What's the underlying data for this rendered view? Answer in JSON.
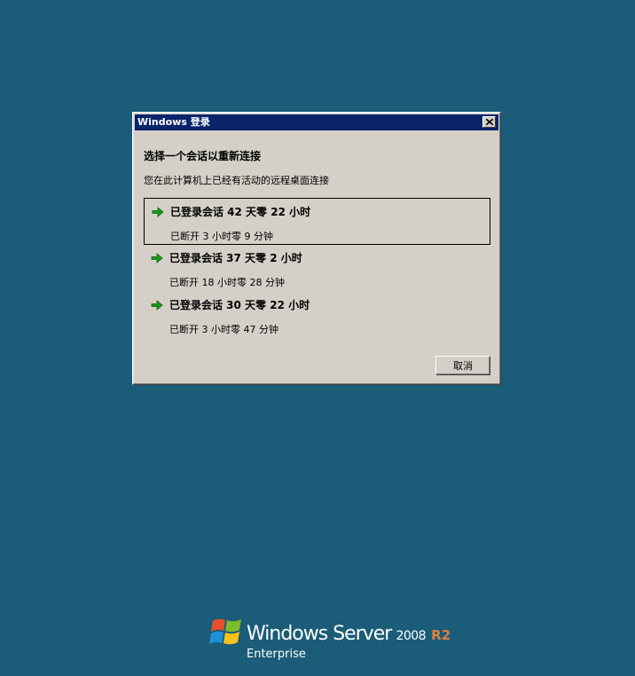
{
  "dialog": {
    "title": "Windows 登录",
    "heading": "选择一个会话以重新连接",
    "subheading": "您在此计算机上已经有活动的远程桌面连接",
    "sessions": [
      {
        "title": "已登录会话 42 天零 22 小时",
        "status": "已断开 3 小时零 9 分钟",
        "selected": true
      },
      {
        "title": "已登录会话 37 天零 2 小时",
        "status": "已断开 18 小时零 28 分钟",
        "selected": false
      },
      {
        "title": "已登录会话 30 天零 22 小时",
        "status": "已断开 3 小时零 47 分钟",
        "selected": false
      }
    ],
    "cancel_label": "取消",
    "icons": {
      "close": "close-icon",
      "session_arrow": "green-arrow-icon"
    }
  },
  "branding": {
    "product": "Windows Server",
    "version": "2008",
    "release": "R2",
    "edition": "Enterprise",
    "logo_icon": "windows-flag-icon"
  },
  "colors": {
    "desktop_background": "#1b5c78",
    "titlebar": "#0a246a",
    "dialog_face": "#d4d0c8",
    "arrow_green": "#1a9a1a",
    "release_accent": "#e07f3e"
  }
}
